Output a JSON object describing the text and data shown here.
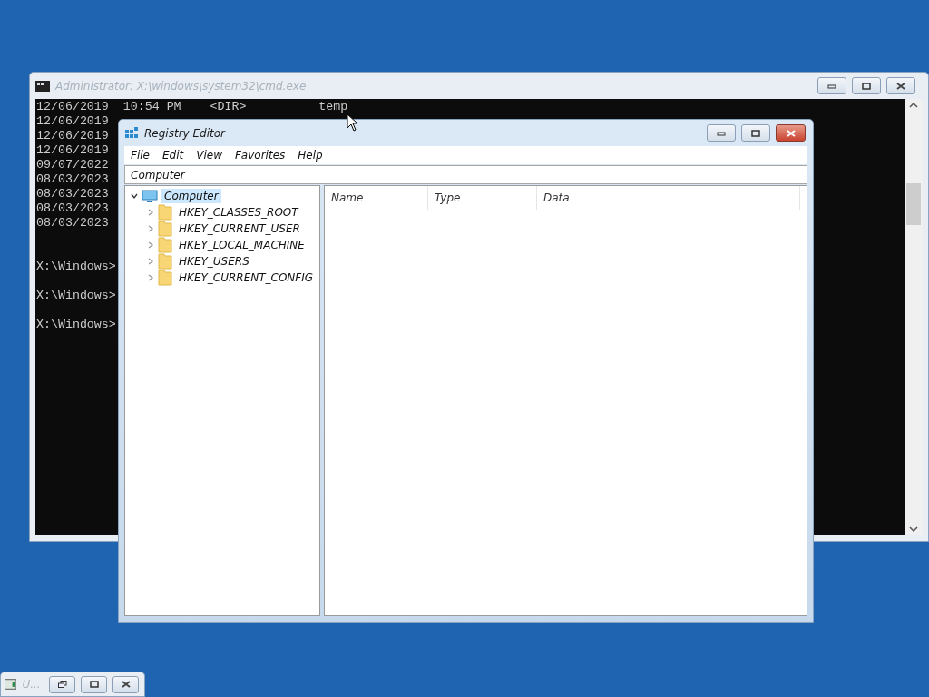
{
  "console_window": {
    "title": "Administrator: X:\\windows\\system32\\cmd.exe",
    "active": false,
    "lines": [
      "12/06/2019  10:54 PM    <DIR>          temp",
      "12/06/2019",
      "12/06/2019",
      "12/06/2019",
      "09/07/2022",
      "08/03/2023",
      "08/03/2023",
      "08/03/2023",
      "08/03/2023"
    ],
    "prompts": [
      "X:\\Windows>",
      "X:\\Windows>",
      "X:\\Windows>"
    ]
  },
  "registry_editor": {
    "title": "Registry Editor",
    "active": true,
    "menu": [
      "File",
      "Edit",
      "View",
      "Favorites",
      "Help"
    ],
    "address": "Computer",
    "tree": {
      "label": "Computer",
      "expanded": true,
      "selected": true,
      "children": [
        {
          "label": "HKEY_CLASSES_ROOT",
          "expanded": false,
          "selected": false
        },
        {
          "label": "HKEY_CURRENT_USER",
          "expanded": false,
          "selected": false
        },
        {
          "label": "HKEY_LOCAL_MACHINE",
          "expanded": false,
          "selected": false
        },
        {
          "label": "HKEY_USERS",
          "expanded": false,
          "selected": false
        },
        {
          "label": "HKEY_CURRENT_CONFIG",
          "expanded": false,
          "selected": false
        }
      ]
    },
    "columns": [
      "Name",
      "Type",
      "Data"
    ]
  },
  "minimized_window": {
    "title": "U..."
  }
}
